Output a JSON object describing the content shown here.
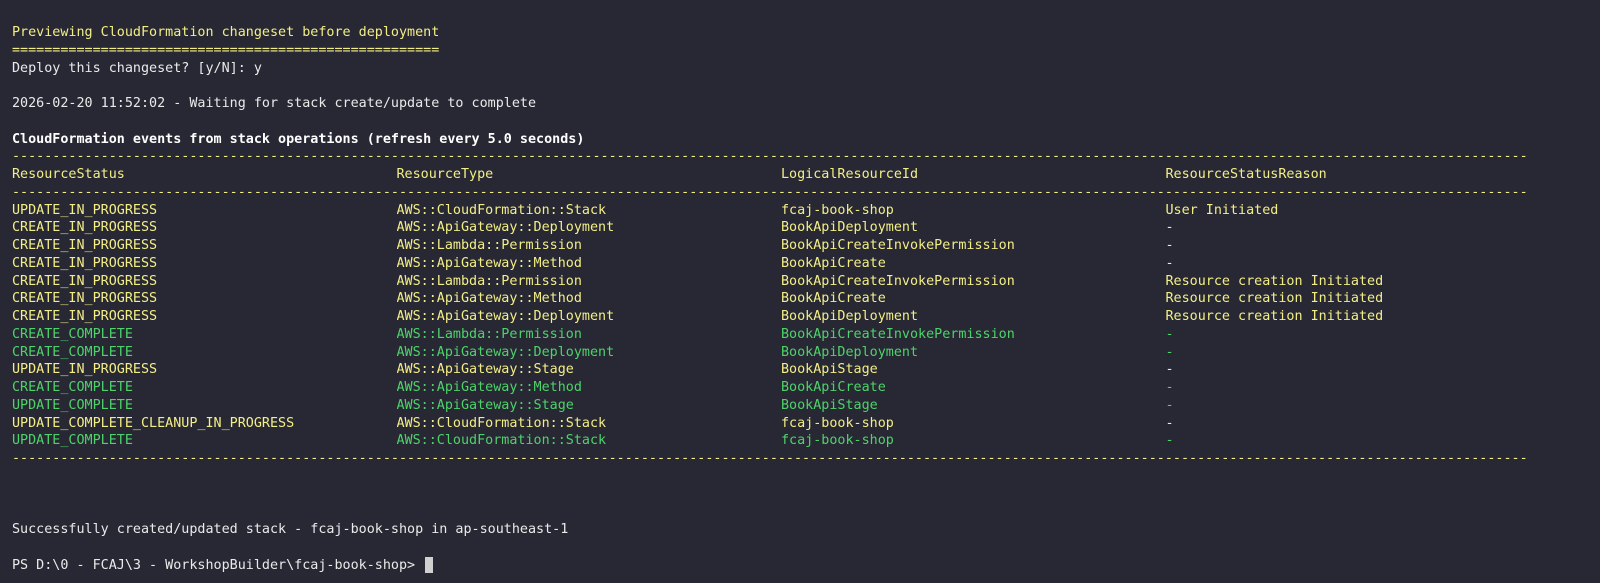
{
  "terminal": {
    "preview_title": "Previewing CloudFormation changeset before deployment",
    "preview_underline": "=====================================================",
    "deploy_prompt": "Deploy this changeset? [y/N]: y",
    "waiting_line": "2026-02-20 11:52:02 - Waiting for stack create/update to complete",
    "events_title": "CloudFormation events from stack operations (refresh every 5.0 seconds)",
    "separator": "-----------------------------------------------------------------------------------------------------------------------------------------------------------------------------------------------------------------------------------------------------",
    "headers": [
      "ResourceStatus",
      "ResourceType",
      "LogicalResourceId",
      "ResourceStatusReason"
    ],
    "rows": [
      {
        "status": "UPDATE_IN_PROGRESS",
        "type": "AWS::CloudFormation::Stack",
        "logical_id": "fcaj-book-shop",
        "reason": "User Initiated",
        "color": "yellow"
      },
      {
        "status": "CREATE_IN_PROGRESS",
        "type": "AWS::ApiGateway::Deployment",
        "logical_id": "BookApiDeployment",
        "reason": "-",
        "color": "yellow"
      },
      {
        "status": "CREATE_IN_PROGRESS",
        "type": "AWS::Lambda::Permission",
        "logical_id": "BookApiCreateInvokePermission",
        "reason": "-",
        "color": "yellow"
      },
      {
        "status": "CREATE_IN_PROGRESS",
        "type": "AWS::ApiGateway::Method",
        "logical_id": "BookApiCreate",
        "reason": "-",
        "color": "yellow"
      },
      {
        "status": "CREATE_IN_PROGRESS",
        "type": "AWS::Lambda::Permission",
        "logical_id": "BookApiCreateInvokePermission",
        "reason": "Resource creation Initiated",
        "color": "yellow"
      },
      {
        "status": "CREATE_IN_PROGRESS",
        "type": "AWS::ApiGateway::Method",
        "logical_id": "BookApiCreate",
        "reason": "Resource creation Initiated",
        "color": "yellow"
      },
      {
        "status": "CREATE_IN_PROGRESS",
        "type": "AWS::ApiGateway::Deployment",
        "logical_id": "BookApiDeployment",
        "reason": "Resource creation Initiated",
        "color": "yellow"
      },
      {
        "status": "CREATE_COMPLETE",
        "type": "AWS::Lambda::Permission",
        "logical_id": "BookApiCreateInvokePermission",
        "reason": "-",
        "color": "green"
      },
      {
        "status": "CREATE_COMPLETE",
        "type": "AWS::ApiGateway::Deployment",
        "logical_id": "BookApiDeployment",
        "reason": "-",
        "color": "green"
      },
      {
        "status": "UPDATE_IN_PROGRESS",
        "type": "AWS::ApiGateway::Stage",
        "logical_id": "BookApiStage",
        "reason": "-",
        "color": "yellow"
      },
      {
        "status": "CREATE_COMPLETE",
        "type": "AWS::ApiGateway::Method",
        "logical_id": "BookApiCreate",
        "reason": "-",
        "color": "green"
      },
      {
        "status": "UPDATE_COMPLETE",
        "type": "AWS::ApiGateway::Stage",
        "logical_id": "BookApiStage",
        "reason": "-",
        "color": "green"
      },
      {
        "status": "UPDATE_COMPLETE_CLEANUP_IN_PROGRESS",
        "type": "AWS::CloudFormation::Stack",
        "logical_id": "fcaj-book-shop",
        "reason": "-",
        "color": "yellow"
      },
      {
        "status": "UPDATE_COMPLETE",
        "type": "AWS::CloudFormation::Stack",
        "logical_id": "fcaj-book-shop",
        "reason": "-",
        "color": "green"
      }
    ],
    "success_line": "Successfully created/updated stack - fcaj-book-shop in ap-southeast-1",
    "prompt": "PS D:\\0 - FCAJ\\3 - WorkshopBuilder\\fcaj-book-shop> "
  },
  "colors": {
    "background": "#272833",
    "in_progress": "#f3ee87",
    "complete": "#4ed36a",
    "text": "#eaeaea"
  }
}
